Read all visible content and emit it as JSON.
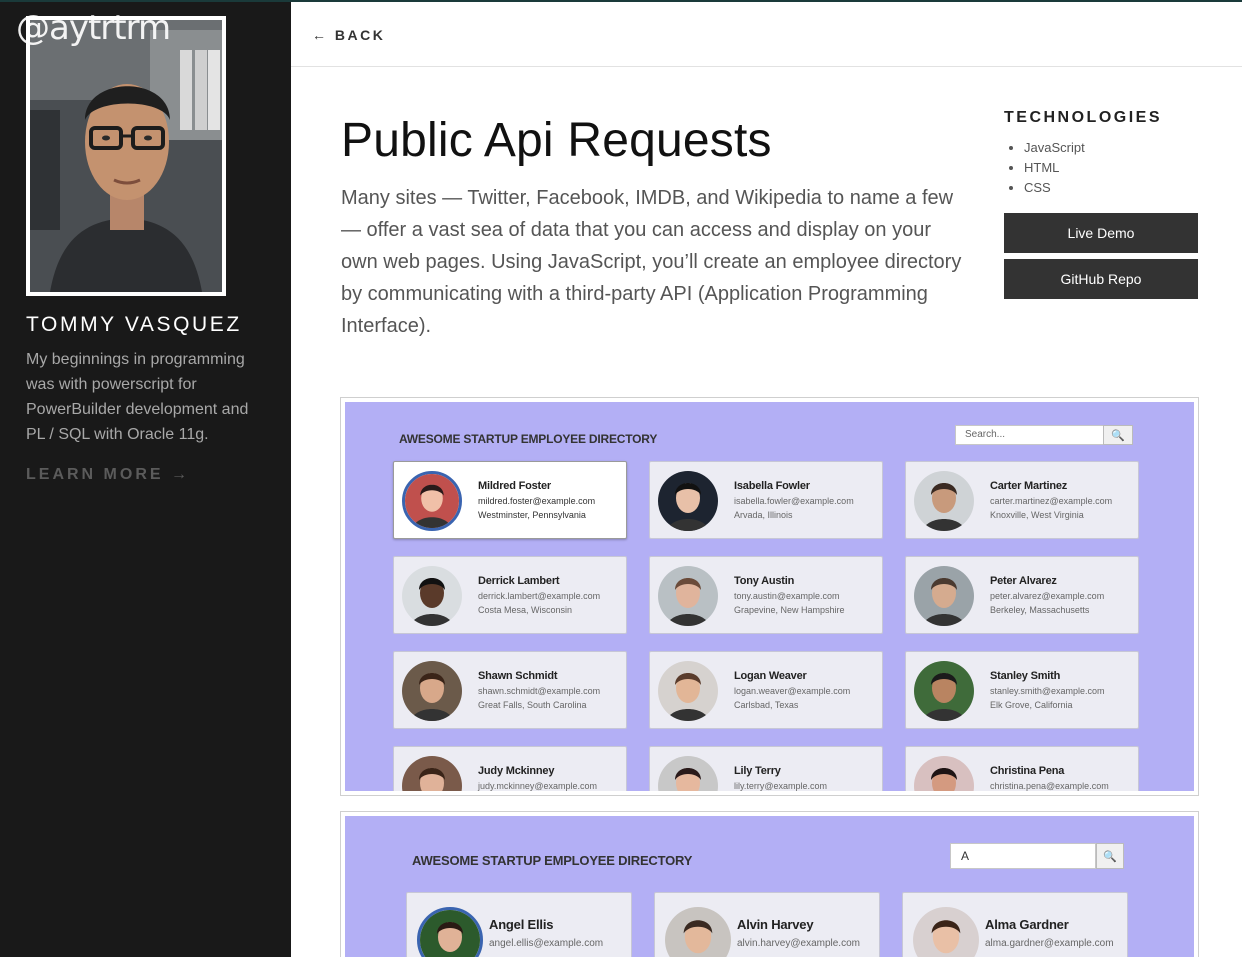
{
  "sidebar": {
    "handle": "@aytrtrm",
    "name": "TOMMY VASQUEZ",
    "bio": "My beginnings in programming was with powerscript for PowerBuilder development and PL / SQL with Oracle 11g.",
    "learn_more": "LEARN MORE →"
  },
  "header": {
    "back": "← BACK"
  },
  "project": {
    "title": "Public Api Requests",
    "description": "Many sites — Twitter, Facebook, IMDB, and Wikipedia to name a few — offer a vast sea of data that you can access and display on your own web pages. Using JavaScript, you’ll create an employee directory by communicating with a third-party API (Application Programming Interface).",
    "technologies_heading": "TECHNOLOGIES",
    "technologies": [
      "JavaScript",
      "HTML",
      "CSS"
    ],
    "live_demo": "Live Demo",
    "github_repo": "GitHub Repo"
  },
  "screenshot1": {
    "directory_title": "AWESOME STARTUP EMPLOYEE DIRECTORY",
    "search_placeholder": "Search...",
    "search_icon": "magnifier-icon",
    "employees": [
      {
        "name": "Mildred Foster",
        "email": "mildred.foster@example.com",
        "location": "Westminster, Pennsylvania"
      },
      {
        "name": "Isabella Fowler",
        "email": "isabella.fowler@example.com",
        "location": "Arvada, Illinois"
      },
      {
        "name": "Carter Martinez",
        "email": "carter.martinez@example.com",
        "location": "Knoxville, West Virginia"
      },
      {
        "name": "Derrick Lambert",
        "email": "derrick.lambert@example.com",
        "location": "Costa Mesa, Wisconsin"
      },
      {
        "name": "Tony Austin",
        "email": "tony.austin@example.com",
        "location": "Grapevine, New Hampshire"
      },
      {
        "name": "Peter Alvarez",
        "email": "peter.alvarez@example.com",
        "location": "Berkeley, Massachusetts"
      },
      {
        "name": "Shawn Schmidt",
        "email": "shawn.schmidt@example.com",
        "location": "Great Falls, South Carolina"
      },
      {
        "name": "Logan Weaver",
        "email": "logan.weaver@example.com",
        "location": "Carlsbad, Texas"
      },
      {
        "name": "Stanley Smith",
        "email": "stanley.smith@example.com",
        "location": "Elk Grove, California"
      },
      {
        "name": "Judy Mckinney",
        "email": "judy.mckinney@example.com",
        "location": ""
      },
      {
        "name": "Lily Terry",
        "email": "lily.terry@example.com",
        "location": ""
      },
      {
        "name": "Christina Pena",
        "email": "christina.pena@example.com",
        "location": ""
      }
    ]
  },
  "screenshot2": {
    "directory_title": "AWESOME STARTUP EMPLOYEE DIRECTORY",
    "search_value": "A",
    "search_icon": "magnifier-icon",
    "employees": [
      {
        "name": "Angel Ellis",
        "email": "angel.ellis@example.com"
      },
      {
        "name": "Alvin Harvey",
        "email": "alvin.harvey@example.com"
      },
      {
        "name": "Alma Gardner",
        "email": "alma.gardner@example.com"
      }
    ]
  },
  "colors": {
    "sidebar_bg": "#191919",
    "button_bg": "#333333",
    "screenshot_bg": "#b3aff5",
    "card_bg": "#ececf3",
    "avatar_ring": "#3a64b0"
  }
}
